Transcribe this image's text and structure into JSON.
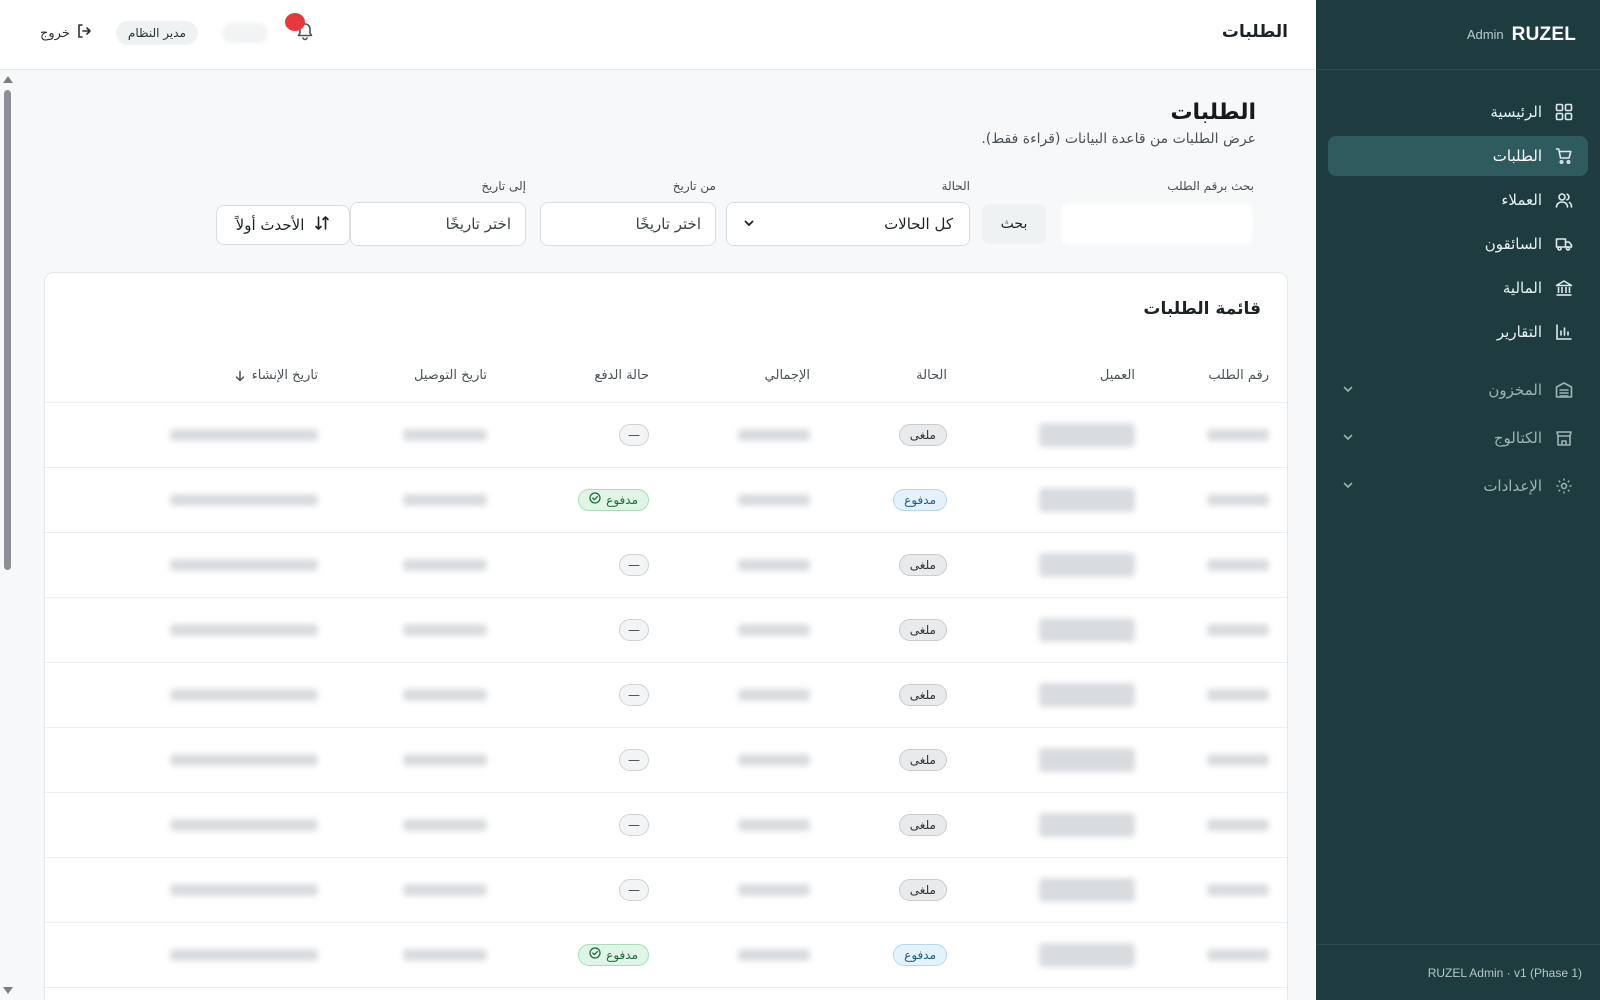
{
  "brand": {
    "name": "RUZEL",
    "sub": "Admin"
  },
  "sidebar": {
    "items": [
      {
        "label": "الرئيسية",
        "icon": "dashboard-grid-icon"
      },
      {
        "label": "الطلبات",
        "icon": "cart-icon",
        "active": true
      },
      {
        "label": "العملاء",
        "icon": "users-icon"
      },
      {
        "label": "السائقون",
        "icon": "truck-icon"
      },
      {
        "label": "المالية",
        "icon": "bank-icon"
      },
      {
        "label": "التقارير",
        "icon": "bar-chart-icon"
      },
      {
        "label": "المخزون",
        "icon": "warehouse-icon",
        "collapsible": true
      },
      {
        "label": "الكتالوج",
        "icon": "store-icon",
        "collapsible": true
      },
      {
        "label": "الإعدادات",
        "icon": "gear-icon",
        "collapsible": true
      }
    ],
    "footer": "RUZEL Admin · v1 (Phase 1)"
  },
  "topbar": {
    "title": "الطلبات",
    "role": "مدير النظام",
    "logout": "خروج"
  },
  "page": {
    "title": "الطلبات",
    "subtitle": "عرض الطلبات من قاعدة البيانات (قراءة فقط)."
  },
  "filters": {
    "search_label": "بحث برقم الطلب",
    "search_button": "بحث",
    "status_label": "الحالة",
    "status_value": "كل الحالات",
    "from_label": "من تاريخ",
    "from_placeholder": "اختر تاريخًا",
    "to_label": "إلى تاريخ",
    "to_placeholder": "اختر تاريخًا",
    "sort_label": "الأحدث أولاً"
  },
  "table": {
    "title": "قائمة الطلبات",
    "columns": {
      "order_no": "رقم الطلب",
      "customer": "العميل",
      "status": "الحالة",
      "total": "الإجمالي",
      "payment": "حالة الدفع",
      "delivery_date": "تاريخ التوصيل",
      "created_at": "تاريخ الإنشاء"
    },
    "rows": [
      {
        "status": "ملغى",
        "status_type": "cancel",
        "payment": "—",
        "payment_type": "dash"
      },
      {
        "status": "مدفوع",
        "status_type": "paid",
        "payment": "مدفوع",
        "payment_type": "paid"
      },
      {
        "status": "ملغى",
        "status_type": "cancel",
        "payment": "—",
        "payment_type": "dash"
      },
      {
        "status": "ملغى",
        "status_type": "cancel",
        "payment": "—",
        "payment_type": "dash"
      },
      {
        "status": "ملغى",
        "status_type": "cancel",
        "payment": "—",
        "payment_type": "dash"
      },
      {
        "status": "ملغى",
        "status_type": "cancel",
        "payment": "—",
        "payment_type": "dash"
      },
      {
        "status": "ملغى",
        "status_type": "cancel",
        "payment": "—",
        "payment_type": "dash"
      },
      {
        "status": "ملغى",
        "status_type": "cancel",
        "payment": "—",
        "payment_type": "dash"
      },
      {
        "status": "مدفوع",
        "status_type": "paid",
        "payment": "مدفوع",
        "payment_type": "paid"
      }
    ]
  },
  "colors": {
    "sidebar_bg": "#1e3c3f",
    "sidebar_active": "#2f5a5e",
    "notification_dot": "#e5393d"
  }
}
